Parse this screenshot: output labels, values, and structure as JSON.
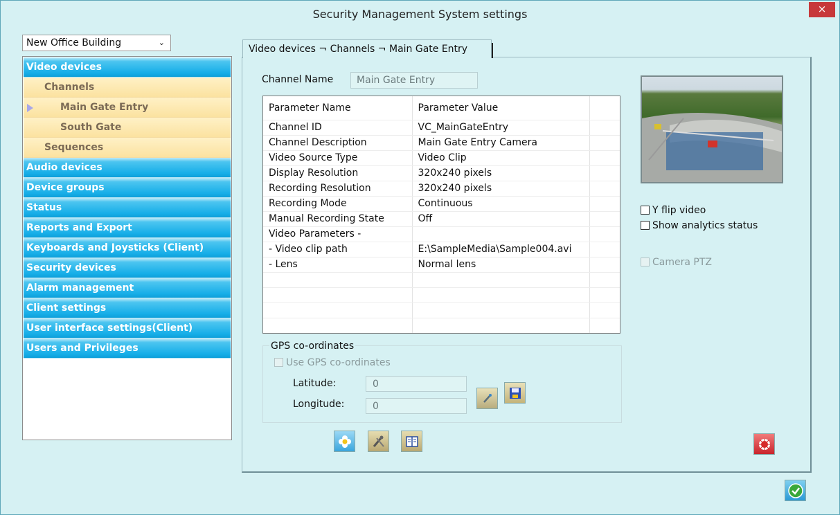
{
  "window": {
    "title": "Security Management System settings",
    "close_glyph": "×"
  },
  "site_select": {
    "value": "New Office Building"
  },
  "nav": {
    "video_devices": "Video devices",
    "channels": "Channels",
    "main_gate_entry": "Main Gate Entry",
    "south_gate": "South Gate",
    "sequences": "Sequences",
    "items": [
      "Audio devices",
      "Device groups",
      "Status",
      "Reports and Export",
      "Keyboards and Joysticks (Client)",
      "Security devices",
      "Alarm management",
      "Client settings",
      "User interface settings(Client)",
      "Users and Privileges"
    ]
  },
  "tab": {
    "label": "Video devices ¬ Channels ¬ Main Gate Entry"
  },
  "channel": {
    "label": "Channel Name",
    "value": "Main Gate Entry"
  },
  "grid": {
    "headers": [
      "Parameter Name",
      "Parameter Value"
    ],
    "rows": [
      [
        "Channel ID",
        "VC_MainGateEntry"
      ],
      [
        "Channel Description",
        "Main Gate Entry Camera"
      ],
      [
        "Video Source Type",
        "Video Clip"
      ],
      [
        "Display Resolution",
        "320x240 pixels"
      ],
      [
        "Recording Resolution",
        "320x240 pixels"
      ],
      [
        "Recording Mode",
        "Continuous"
      ],
      [
        "Manual Recording State",
        "Off"
      ],
      [
        "Video Parameters -",
        ""
      ],
      [
        "- Video clip path",
        "E:\\SampleMedia\\Sample004.avi"
      ],
      [
        "- Lens",
        "Normal lens"
      ]
    ]
  },
  "gps": {
    "title": "GPS co-ordinates",
    "use_label": "Use GPS co-ordinates",
    "latitude_label": "Latitude:",
    "latitude_value": "0",
    "longitude_label": "Longitude:",
    "longitude_value": "0"
  },
  "options": {
    "y_flip": "Y flip video",
    "analytics": "Show analytics status",
    "ptz": "Camera PTZ"
  },
  "icons": {
    "pick_location": "pick-location-icon",
    "save_location": "save-icon",
    "flower": "flower-icon",
    "tools": "tools-icon",
    "book": "book-icon",
    "record": "record-icon",
    "ok": "checkmark-icon"
  }
}
